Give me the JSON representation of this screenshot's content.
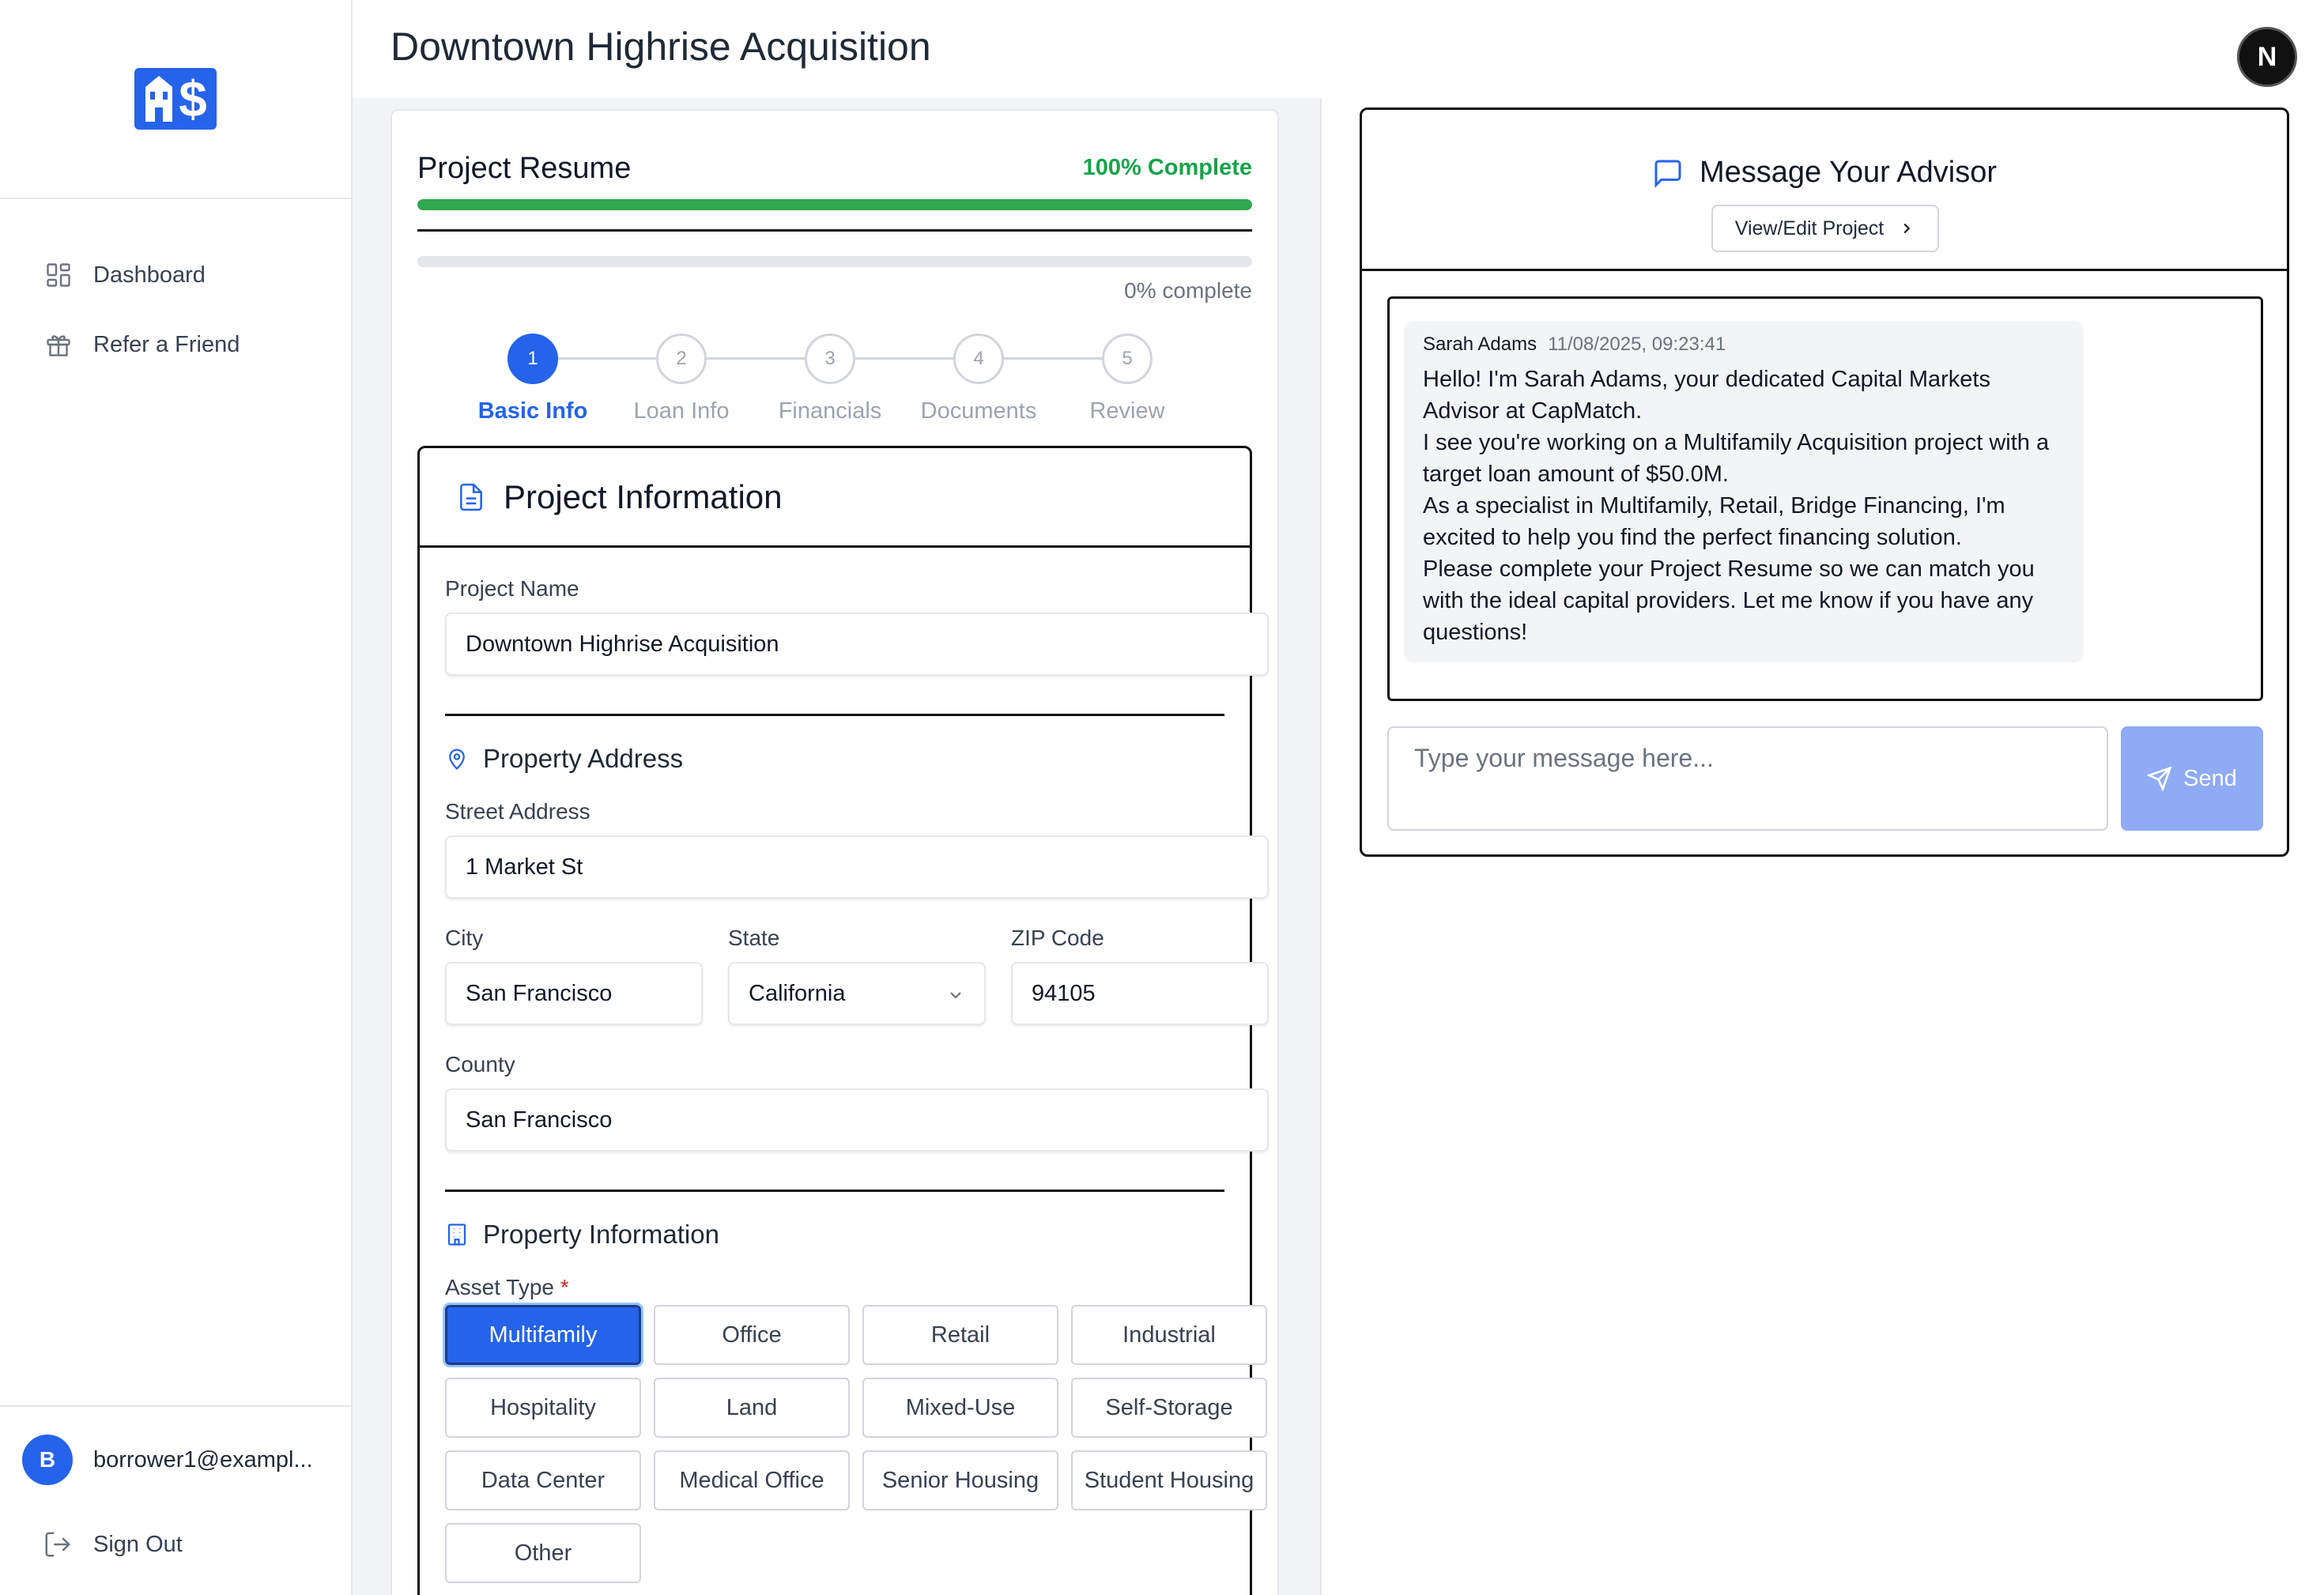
{
  "header": {
    "title": "Downtown Highrise Acquisition",
    "user_badge": "N"
  },
  "sidebar": {
    "logo_text": "$",
    "items": [
      {
        "label": "Dashboard",
        "icon": "dashboard-icon"
      },
      {
        "label": "Refer a Friend",
        "icon": "gift-icon"
      }
    ],
    "user": {
      "initial": "B",
      "email": "borrower1@exampl..."
    },
    "sign_out": "Sign Out"
  },
  "resume": {
    "title": "Project Resume",
    "complete_label": "100% Complete",
    "complete_value": 1.0,
    "section_progress_value": 0.0,
    "section_progress_label": "0% complete",
    "steps": [
      {
        "num": "1",
        "label": "Basic Info",
        "active": true
      },
      {
        "num": "2",
        "label": "Loan Info",
        "active": false
      },
      {
        "num": "3",
        "label": "Financials",
        "active": false
      },
      {
        "num": "4",
        "label": "Documents",
        "active": false
      },
      {
        "num": "5",
        "label": "Review",
        "active": false
      }
    ],
    "section_title": "Project Information",
    "project_name_label": "Project Name",
    "project_name_value": "Downtown Highrise Acquisition",
    "address_heading": "Property Address",
    "street_label": "Street Address",
    "street_value": "1 Market St",
    "city_label": "City",
    "city_value": "San Francisco",
    "state_label": "State",
    "state_value": "California",
    "zip_label": "ZIP Code",
    "zip_value": "94105",
    "county_label": "County",
    "county_value": "San Francisco",
    "property_heading": "Property Information",
    "asset_type_label": "Asset Type",
    "asset_required": "*",
    "asset_types": [
      "Multifamily",
      "Office",
      "Retail",
      "Industrial",
      "Hospitality",
      "Land",
      "Mixed-Use",
      "Self-Storage",
      "Data Center",
      "Medical Office",
      "Senior Housing",
      "Student Housing",
      "Other"
    ],
    "asset_selected": "Multifamily"
  },
  "chat": {
    "title": "Message Your Advisor",
    "view_edit": "View/Edit Project",
    "message": {
      "sender": "Sarah Adams",
      "time": "11/08/2025, 09:23:41",
      "text": "Hello! I'm Sarah Adams, your dedicated Capital Markets Advisor at CapMatch.\nI see you're working on a Multifamily Acquisition project with a target loan amount of $50.0M.\nAs a specialist in Multifamily, Retail, Bridge Financing, I'm excited to help you find the perfect financing solution.\nPlease complete your Project Resume so we can match you with the ideal capital providers. Let me know if you have any questions!"
    },
    "input_placeholder": "Type your message here...",
    "send_label": "Send"
  },
  "colors": {
    "accent": "#2563eb",
    "success": "#16a34a",
    "send_disabled": "#8fabf5"
  }
}
